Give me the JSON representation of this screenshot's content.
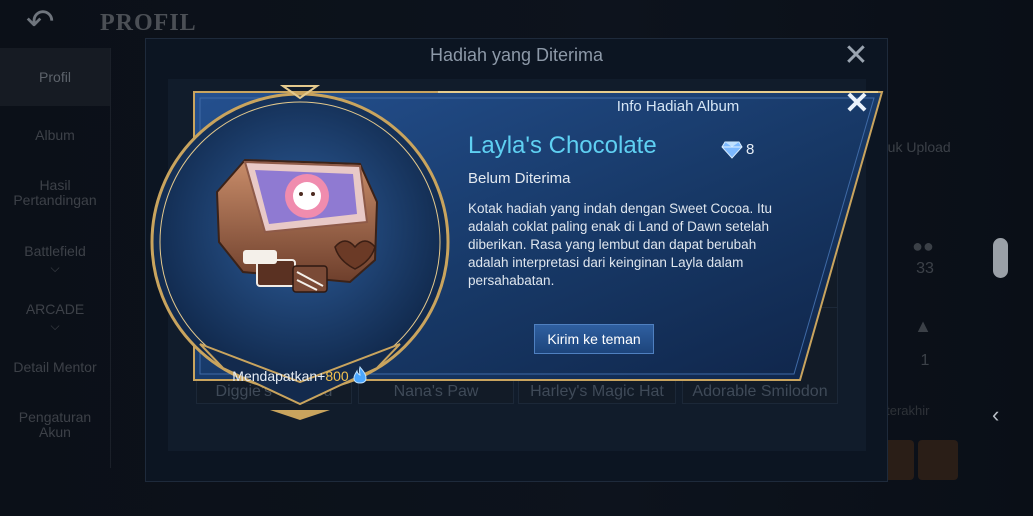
{
  "background": {
    "title": "PROFIL",
    "sidebar": [
      {
        "label": "Profil",
        "active": true
      },
      {
        "label": "Album",
        "active": false
      },
      {
        "label": "Hasil Pertandingan",
        "active": false
      },
      {
        "label": "Battlefield",
        "active": false,
        "chevron": true
      },
      {
        "label": "ARCADE",
        "active": false,
        "chevron": true
      },
      {
        "label": "Detail Mentor",
        "active": false
      },
      {
        "label": "Pengaturan Akun",
        "active": false
      }
    ],
    "right_text": "ntuk Upload",
    "stats": [
      {
        "icon": "people-icon",
        "value": "33"
      },
      {
        "icon": "thumbs-up-icon",
        "value": "1"
      }
    ],
    "recent_label": "y terakhir"
  },
  "outer_dialog": {
    "title": "Hadiah yang Diterima",
    "cards": [
      "Diggie's Colored",
      "Nana's Paw",
      "Harley's Magic Hat",
      "Adorable Smilodon"
    ],
    "partial_card_text": "e"
  },
  "popup": {
    "title": "Info Hadiah Album",
    "item_name": "Layla's Chocolate",
    "gem_count": "8",
    "status": "Belum Diterima",
    "description": "Kotak hadiah yang indah dengan Sweet Cocoa. Itu adalah coklat paling enak di Land of Dawn setelah diberikan. Rasa yang lembut dan dapat berubah adalah interpretasi dari keinginan Layla dalam persahabatan.",
    "send_button": "Kirim ke teman",
    "reward_label": "Mendapatkan+",
    "reward_value": "800"
  },
  "colors": {
    "accent_cyan": "#5fd0f2",
    "gold": "#d9b46a",
    "button_blue": "#2f5fa0",
    "reward_gold": "#f2c14e"
  }
}
